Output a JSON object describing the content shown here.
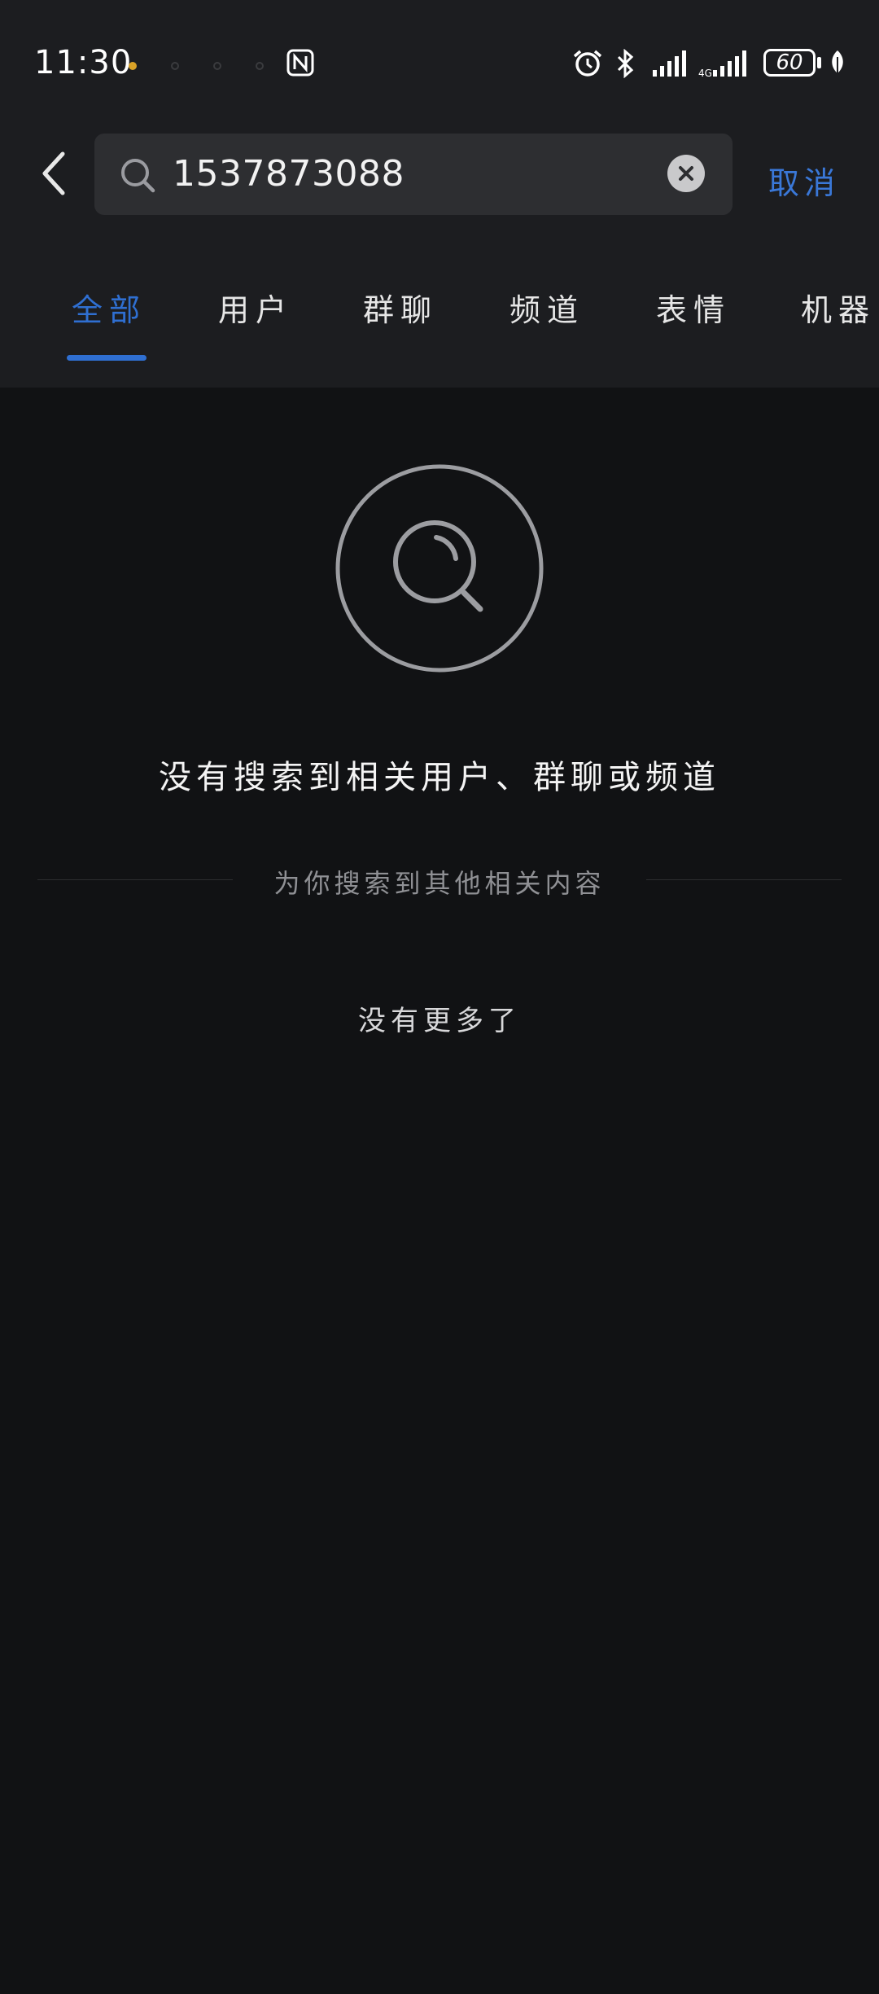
{
  "status_bar": {
    "time": "11:30",
    "battery": "60"
  },
  "search": {
    "query": "1537873088",
    "cancel_label": "取消"
  },
  "tabs": [
    {
      "label": "全部",
      "active": true
    },
    {
      "label": "用户",
      "active": false
    },
    {
      "label": "群聊",
      "active": false
    },
    {
      "label": "频道",
      "active": false
    },
    {
      "label": "表情",
      "active": false
    },
    {
      "label": "机器",
      "active": false
    }
  ],
  "empty_state": {
    "title": "没有搜索到相关用户、群聊或频道",
    "related_divider": "为你搜索到其他相关内容",
    "no_more": "没有更多了"
  },
  "colors": {
    "accent": "#2f6fd1",
    "header_bg": "#1c1d20",
    "page_bg": "#111214",
    "search_bg": "#2d2e31"
  }
}
